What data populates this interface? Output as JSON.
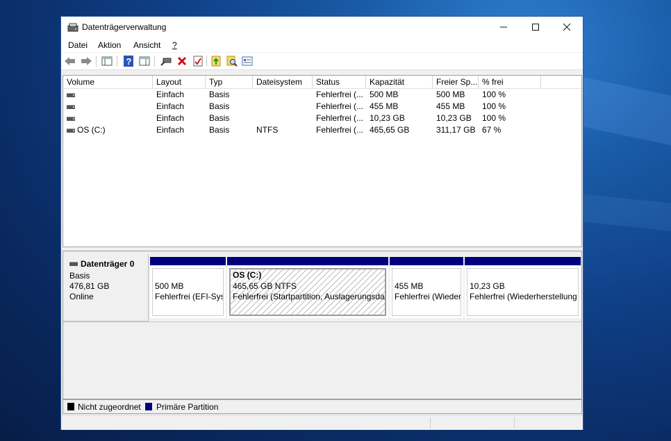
{
  "window": {
    "title": "Datenträgerverwaltung",
    "accent": "#2b5aa3"
  },
  "menu": [
    {
      "label": "Datei"
    },
    {
      "label": "Aktion"
    },
    {
      "label": "Ansicht"
    },
    {
      "label": "?"
    }
  ],
  "toolbar_icons": [
    "back-arrow-icon",
    "forward-arrow-icon",
    "console-tree-icon",
    "help-icon",
    "action-pane-icon",
    "connect-icon",
    "delete-icon",
    "properties-icon",
    "open-folder-icon",
    "search-icon",
    "details-icon"
  ],
  "table": {
    "columns": [
      "Volume",
      "Layout",
      "Typ",
      "Dateisystem",
      "Status",
      "Kapazität",
      "Freier Sp...",
      "% frei"
    ],
    "rows": [
      [
        "",
        "Einfach",
        "Basis",
        "",
        "Fehlerfrei (...",
        "500 MB",
        "500 MB",
        "100 %"
      ],
      [
        "",
        "Einfach",
        "Basis",
        "",
        "Fehlerfrei (...",
        "455 MB",
        "455 MB",
        "100 %"
      ],
      [
        "",
        "Einfach",
        "Basis",
        "",
        "Fehlerfrei (...",
        "10,23 GB",
        "10,23 GB",
        "100 %"
      ],
      [
        "OS (C:)",
        "Einfach",
        "Basis",
        "NTFS",
        "Fehlerfrei (...",
        "465,65 GB",
        "311,17 GB",
        "67 %"
      ]
    ]
  },
  "disk": {
    "name": "Datenträger 0",
    "type": "Basis",
    "size": "476,81 GB",
    "state": "Online",
    "partitions": [
      {
        "title": "",
        "size": "500 MB",
        "status": "Fehlerfrei (EFI-Syst"
      },
      {
        "title": "OS  (C:)",
        "size": "465,65 GB NTFS",
        "status": "Fehlerfrei (Startpartition, Auslagerungsdat"
      },
      {
        "title": "",
        "size": "455 MB",
        "status": "Fehlerfrei (Wieder"
      },
      {
        "title": "",
        "size": "10,23 GB",
        "status": "Fehlerfrei (Wiederherstellung"
      }
    ]
  },
  "legend": [
    {
      "label": "Nicht zugeordnet",
      "color": "#000000"
    },
    {
      "label": "Primäre Partition",
      "color": "#00007f"
    }
  ]
}
